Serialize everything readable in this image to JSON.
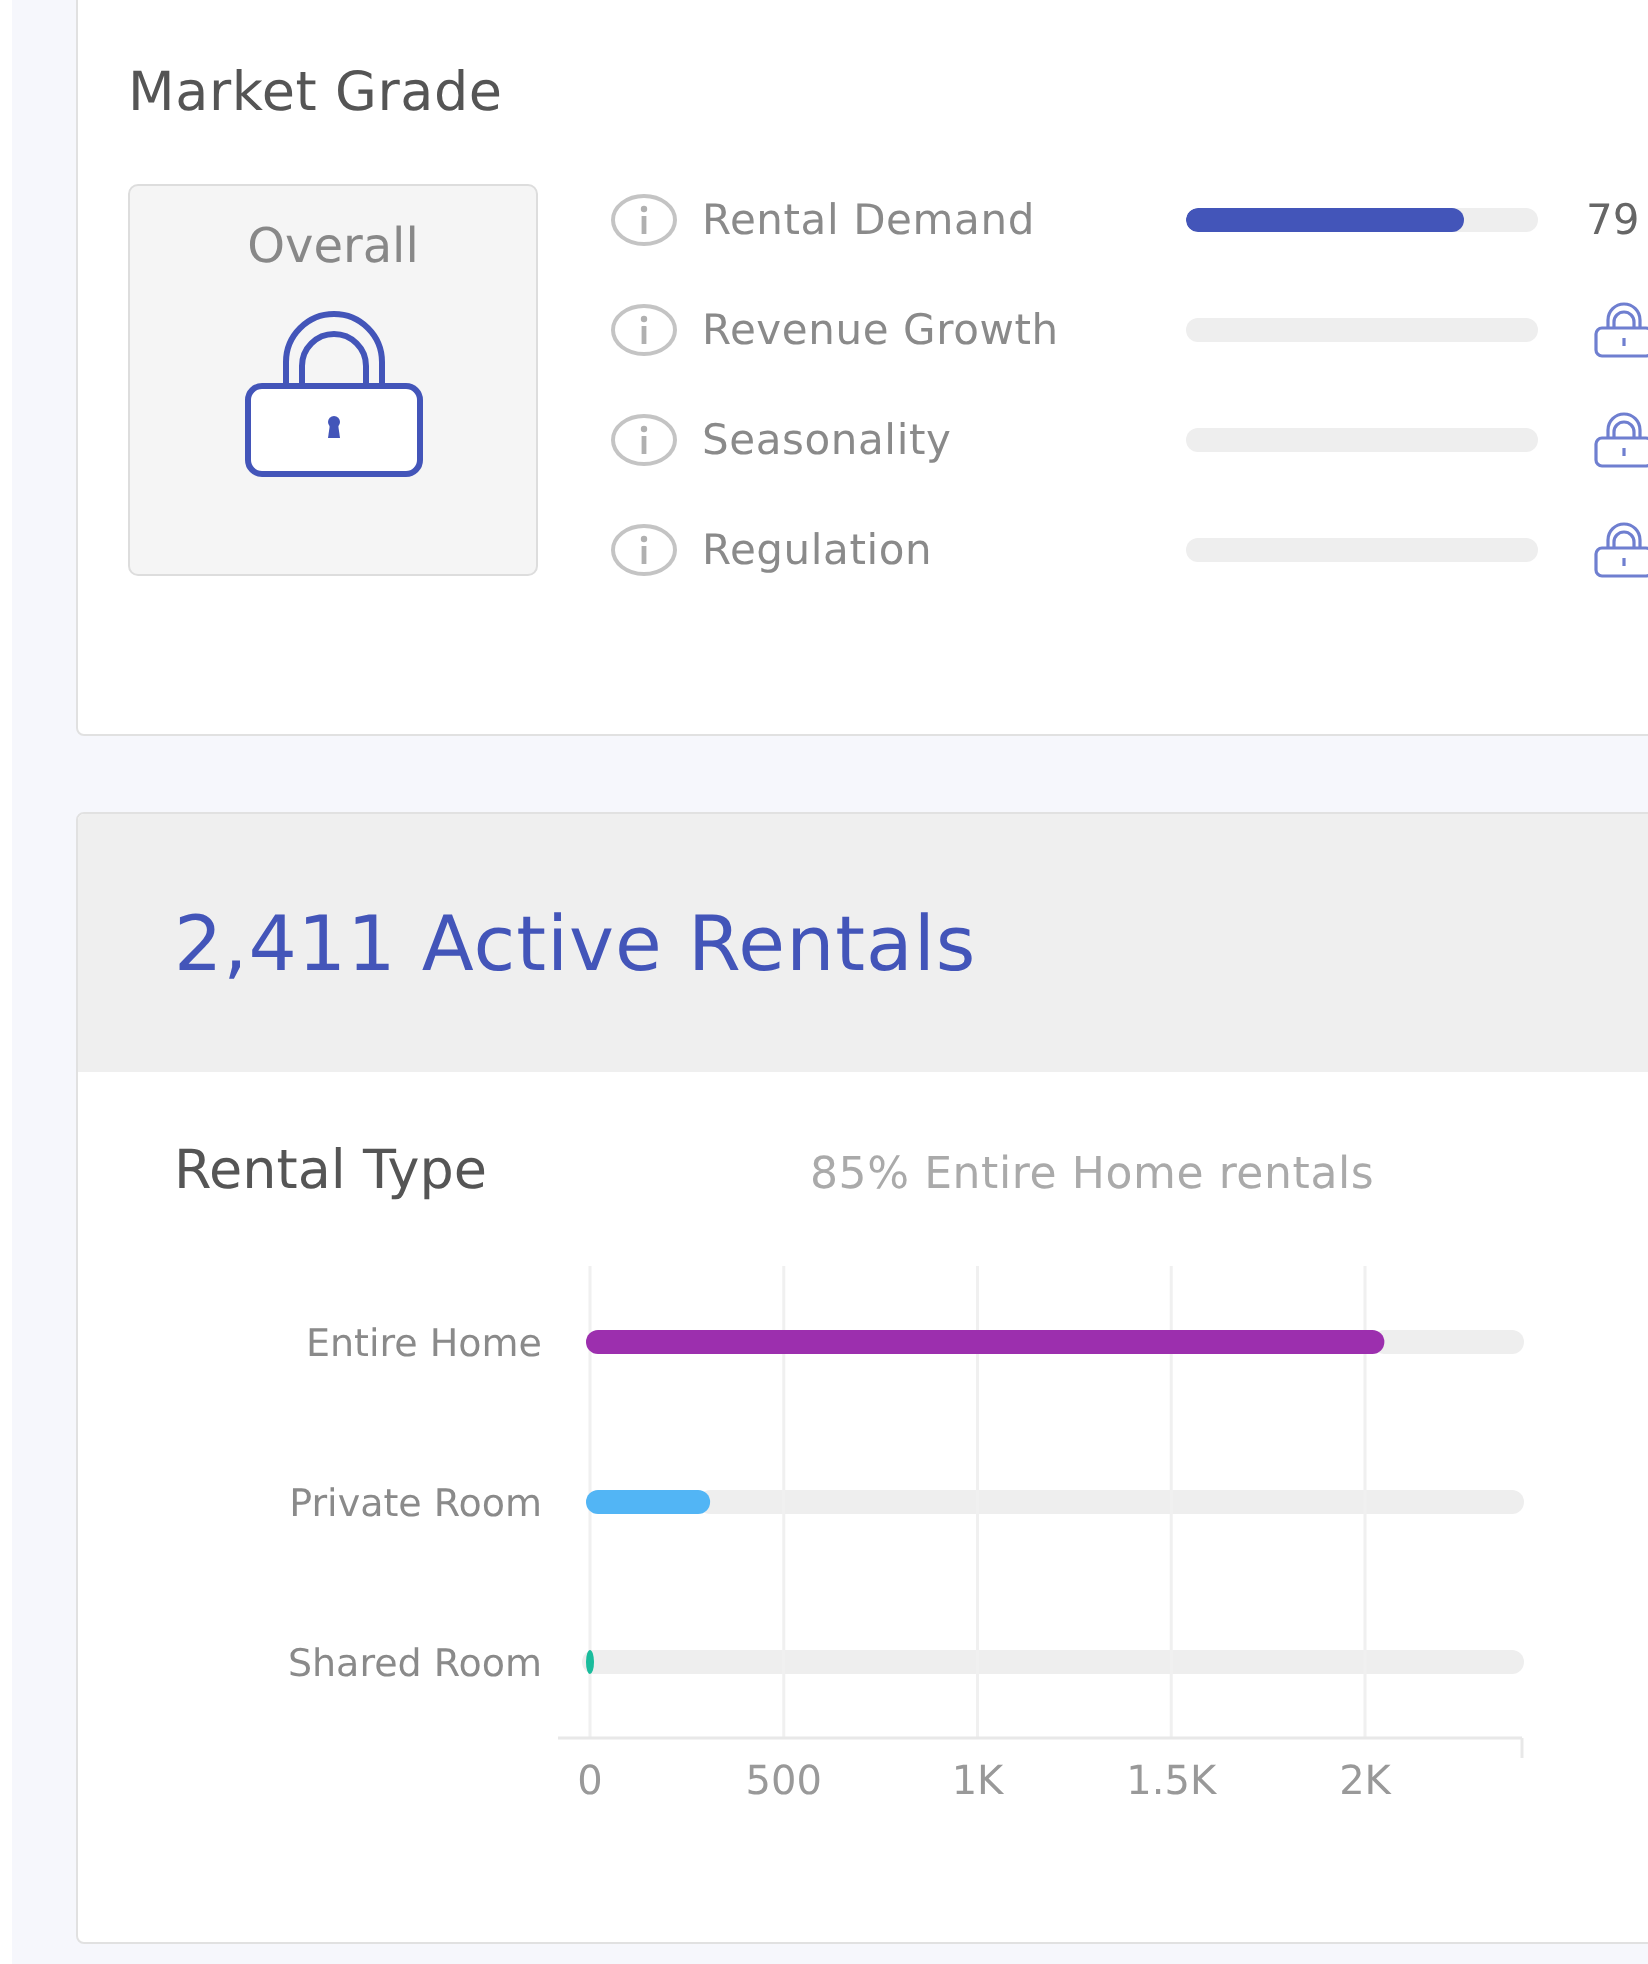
{
  "market_grade": {
    "title": "Market Grade",
    "overall": {
      "label": "Overall",
      "locked": true
    },
    "metrics": [
      {
        "label": "Rental Demand",
        "kind": "score",
        "level": 0.79,
        "reading": "79"
      },
      {
        "label": "Revenue Growth",
        "kind": "locked"
      },
      {
        "label": "Seasonality",
        "kind": "locked"
      },
      {
        "label": "Regulation",
        "kind": "locked"
      }
    ]
  },
  "active_rentals": {
    "title": "2,411 Active Rentals",
    "rental_type": {
      "title": "Rental Type",
      "summary": "85% Entire Home rentals",
      "chart_data": {
        "type": "bar",
        "orientation": "horizontal",
        "grid": true,
        "series": [
          {
            "name": "Entire Home",
            "color": "#9c2fae",
            "values": [
              2050
            ]
          },
          {
            "name": "Private Room",
            "color": "#52b5f5",
            "values": [
              310
            ]
          },
          {
            "name": "Shared Room",
            "color": "#1abc9c",
            "values": [
              10
            ]
          }
        ],
        "xlim": [
          0,
          2400
        ],
        "xticks": [
          0,
          {
            "value": 500,
            "label": "500"
          },
          {
            "value": 1000,
            "label": "1K"
          },
          {
            "value": 1500,
            "label": "1.5K"
          },
          {
            "value": 2000,
            "label": "2K"
          }
        ]
      }
    }
  }
}
